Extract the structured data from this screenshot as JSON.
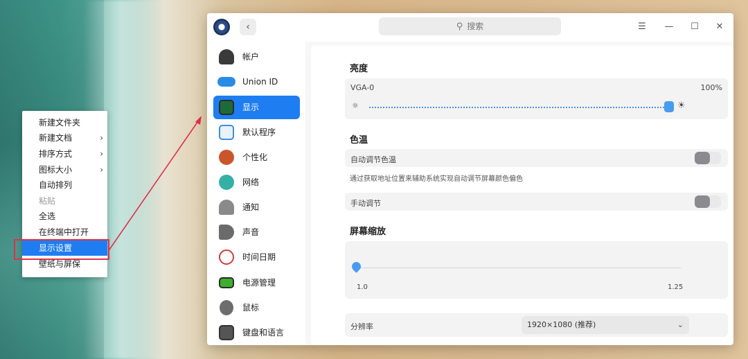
{
  "context_menu": {
    "items": [
      {
        "label": "新建文件夹",
        "submenu": false,
        "disabled": false
      },
      {
        "label": "新建文档",
        "submenu": true,
        "disabled": false
      },
      {
        "label": "排序方式",
        "submenu": true,
        "disabled": false
      },
      {
        "label": "图标大小",
        "submenu": true,
        "disabled": false
      },
      {
        "label": "自动排列",
        "submenu": false,
        "disabled": false
      },
      {
        "label": "粘贴",
        "submenu": false,
        "disabled": true
      },
      {
        "label": "全选",
        "submenu": false,
        "disabled": false
      },
      {
        "label": "在终端中打开",
        "submenu": false,
        "disabled": false
      },
      {
        "label": "显示设置",
        "submenu": false,
        "disabled": false,
        "selected": true
      },
      {
        "label": "壁纸与屏保",
        "submenu": false,
        "disabled": false
      }
    ],
    "submenu_arrow": "›"
  },
  "window": {
    "back_icon": "‹",
    "search_icon": "⚲",
    "search_placeholder": "搜索",
    "menu_icon": "☰",
    "minimize_icon": "—",
    "maximize_icon": "☐",
    "close_icon": "✕"
  },
  "sidebar": {
    "items": [
      {
        "label": "帐户",
        "icon": "account-icon",
        "color": "#3a3a3a"
      },
      {
        "label": "Union ID",
        "icon": "cloud-icon",
        "color": "#2a8be6"
      },
      {
        "label": "显示",
        "icon": "display-icon",
        "color": "#1e6b3a",
        "active": true
      },
      {
        "label": "默认程序",
        "icon": "default-apps-icon",
        "color": "#3c8ee0"
      },
      {
        "label": "个性化",
        "icon": "personalization-icon",
        "color": "#c9562a"
      },
      {
        "label": "网络",
        "icon": "network-icon",
        "color": "#33b1a4"
      },
      {
        "label": "通知",
        "icon": "bell-icon",
        "color": "#8a8a8a"
      },
      {
        "label": "声音",
        "icon": "speaker-icon",
        "color": "#6b6b6b"
      },
      {
        "label": "时间日期",
        "icon": "clock-icon",
        "color": "#d23b3b"
      },
      {
        "label": "电源管理",
        "icon": "battery-icon",
        "color": "#3fae2e"
      },
      {
        "label": "鼠标",
        "icon": "mouse-icon",
        "color": "#6d6d6d"
      },
      {
        "label": "键盘和语言",
        "icon": "keyboard-icon",
        "color": "#555555"
      }
    ]
  },
  "brightness": {
    "title": "亮度",
    "monitor": "VGA-0",
    "value_text": "100%",
    "value": 1.0,
    "sun_low_icon": "☼",
    "sun_high_icon": "☀"
  },
  "color_temp": {
    "title": "色温",
    "auto_label": "自动调节色温",
    "auto_note": "通过获取地址位置来辅助系统实现自动调节屏幕颜色偏色",
    "manual_label": "手动调节",
    "auto_enabled": false,
    "manual_enabled": false
  },
  "scaling": {
    "title": "屏幕缩放",
    "min_label": "1.0",
    "max_label": "1.25",
    "value": 1.0
  },
  "resolution": {
    "label": "分辨率",
    "value": "1920×1080 (推荐)",
    "chevron": "⌄"
  },
  "colors": {
    "accent": "#1f7df2",
    "highlight_border": "#e0304a"
  }
}
